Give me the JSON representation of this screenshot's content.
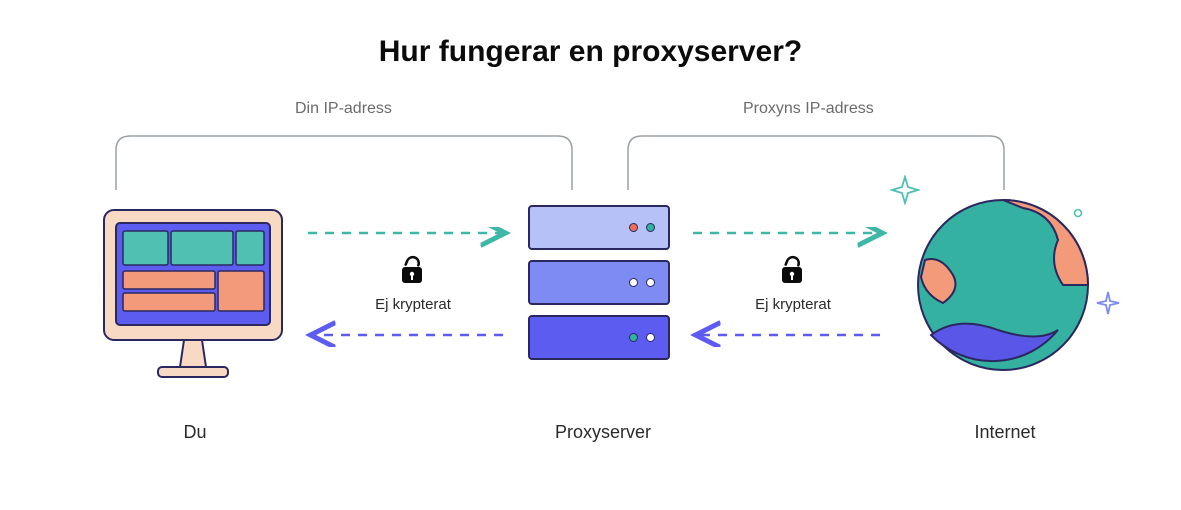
{
  "title": "Hur fungerar en proxyserver?",
  "labels": {
    "you": "Du",
    "proxy": "Proxyserver",
    "internet": "Internet",
    "your_ip": "Din IP-adress",
    "proxy_ip": "Proxyns IP-adress",
    "not_encrypted_left": "Ej krypterat",
    "not_encrypted_right": "Ej krypterat"
  },
  "icons": {
    "computer": "computer-monitor-icon",
    "server": "server-stack-icon",
    "globe": "globe-icon",
    "lock": "unlocked-padlock-icon",
    "sparkle": "sparkle-icon"
  },
  "colors": {
    "teal": "#3fb7a7",
    "indigo": "#5c5df0",
    "orange": "#f39a7a",
    "navy": "#2b2860",
    "gray": "#9aa0a6",
    "teal_fill": "#35b1a2",
    "globe_blue": "#5a56e8"
  }
}
